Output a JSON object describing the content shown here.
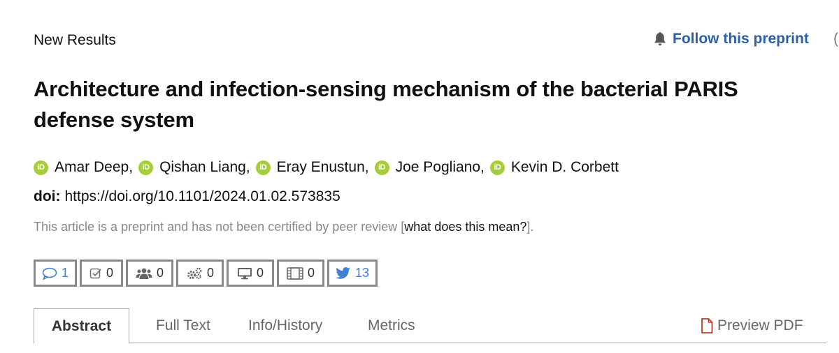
{
  "header": {
    "category": "New Results",
    "follow_label": "Follow this preprint",
    "edge_fragment": "("
  },
  "article": {
    "title": "Architecture and infection-sensing mechanism of the bacterial PARIS defense system",
    "authors": [
      {
        "name": "Amar Deep",
        "sep": ","
      },
      {
        "name": "Qishan Liang",
        "sep": ","
      },
      {
        "name": "Eray Enustun",
        "sep": ","
      },
      {
        "name": "Joe Pogliano",
        "sep": ","
      },
      {
        "name": "Kevin D. Corbett",
        "sep": ""
      }
    ],
    "orcid_badge": "iD",
    "doi_label": "doi:",
    "doi_value": "https://doi.org/10.1101/2024.01.02.573835",
    "review_note_prefix": "This article is a preprint and has not been certified by peer review [",
    "review_note_link": "what does this mean?",
    "review_note_suffix": "]."
  },
  "counters": [
    {
      "icon": "comment-icon",
      "value": "1"
    },
    {
      "icon": "review-check-icon",
      "value": "0"
    },
    {
      "icon": "users-icon",
      "value": "0"
    },
    {
      "icon": "gears-icon",
      "value": "0"
    },
    {
      "icon": "monitor-icon",
      "value": "0"
    },
    {
      "icon": "film-icon",
      "value": "0"
    },
    {
      "icon": "twitter-icon",
      "value": "13"
    }
  ],
  "tabs": {
    "abstract": "Abstract",
    "full_text": "Full Text",
    "info_history": "Info/History",
    "metrics": "Metrics",
    "preview_pdf": "Preview PDF"
  },
  "colors": {
    "link_blue": "#2d5ea8",
    "orcid_green": "#a6ce39",
    "pdf_red": "#c0392b",
    "twitter_blue": "#3f7fd6"
  }
}
